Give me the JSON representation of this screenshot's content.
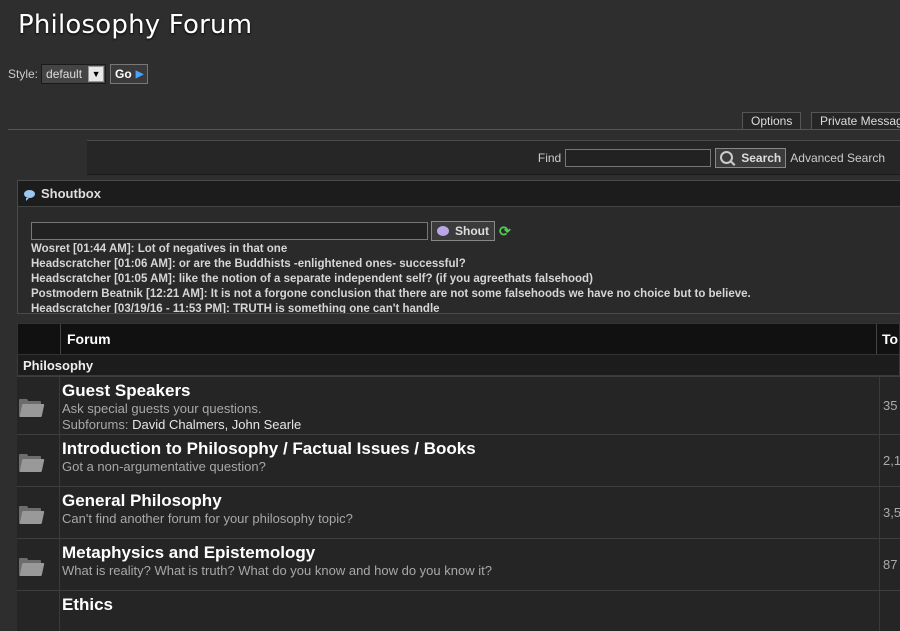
{
  "site_title": "Philosophy Forum",
  "style_bar": {
    "label": "Style:",
    "selected": "default",
    "go_label": "Go"
  },
  "nav_tabs": [
    {
      "label": "Options"
    },
    {
      "label": "Private Messag"
    }
  ],
  "search": {
    "find_label": "Find",
    "value": "",
    "button_label": "Search",
    "advanced_label": "Advanced Search"
  },
  "shoutbox": {
    "title": "Shoutbox",
    "input_value": "",
    "button_label": "Shout",
    "messages": [
      "Wosret [01:44 AM]: Lot of negatives in that one",
      "Headscratcher [01:06 AM]: or are the Buddhists -enlightened ones- successful?",
      "Headscratcher [01:05 AM]: like the notion of a separate independent self? (if you agreethats falsehood)",
      "Postmodern Beatnik [12:21 AM]: It is not a forgone conclusion that there are not some falsehoods we have no choice but to believe.",
      "Headscratcher [03/19/16 - 11:53 PM]: TRUTH is something one can't handle"
    ]
  },
  "forum_table": {
    "headers": {
      "forum": "Forum",
      "topics": "To"
    },
    "category": "Philosophy",
    "forums": [
      {
        "title": "Guest Speakers",
        "description": "Ask special guests your questions.",
        "subforums_label": "Subforums:",
        "subforums": "David Chalmers, John Searle",
        "topics": "35"
      },
      {
        "title": "Introduction to Philosophy / Factual Issues / Books",
        "description": "Got a non-argumentative question?",
        "topics": "2,1"
      },
      {
        "title": "General Philosophy",
        "description": "Can't find another forum for your philosophy topic?",
        "topics": "3,5"
      },
      {
        "title": "Metaphysics and Epistemology",
        "description": "What is reality? What is truth? What do you know and how do you know it?",
        "topics": "87"
      },
      {
        "title": "Ethics",
        "description": "",
        "topics": ""
      }
    ]
  }
}
